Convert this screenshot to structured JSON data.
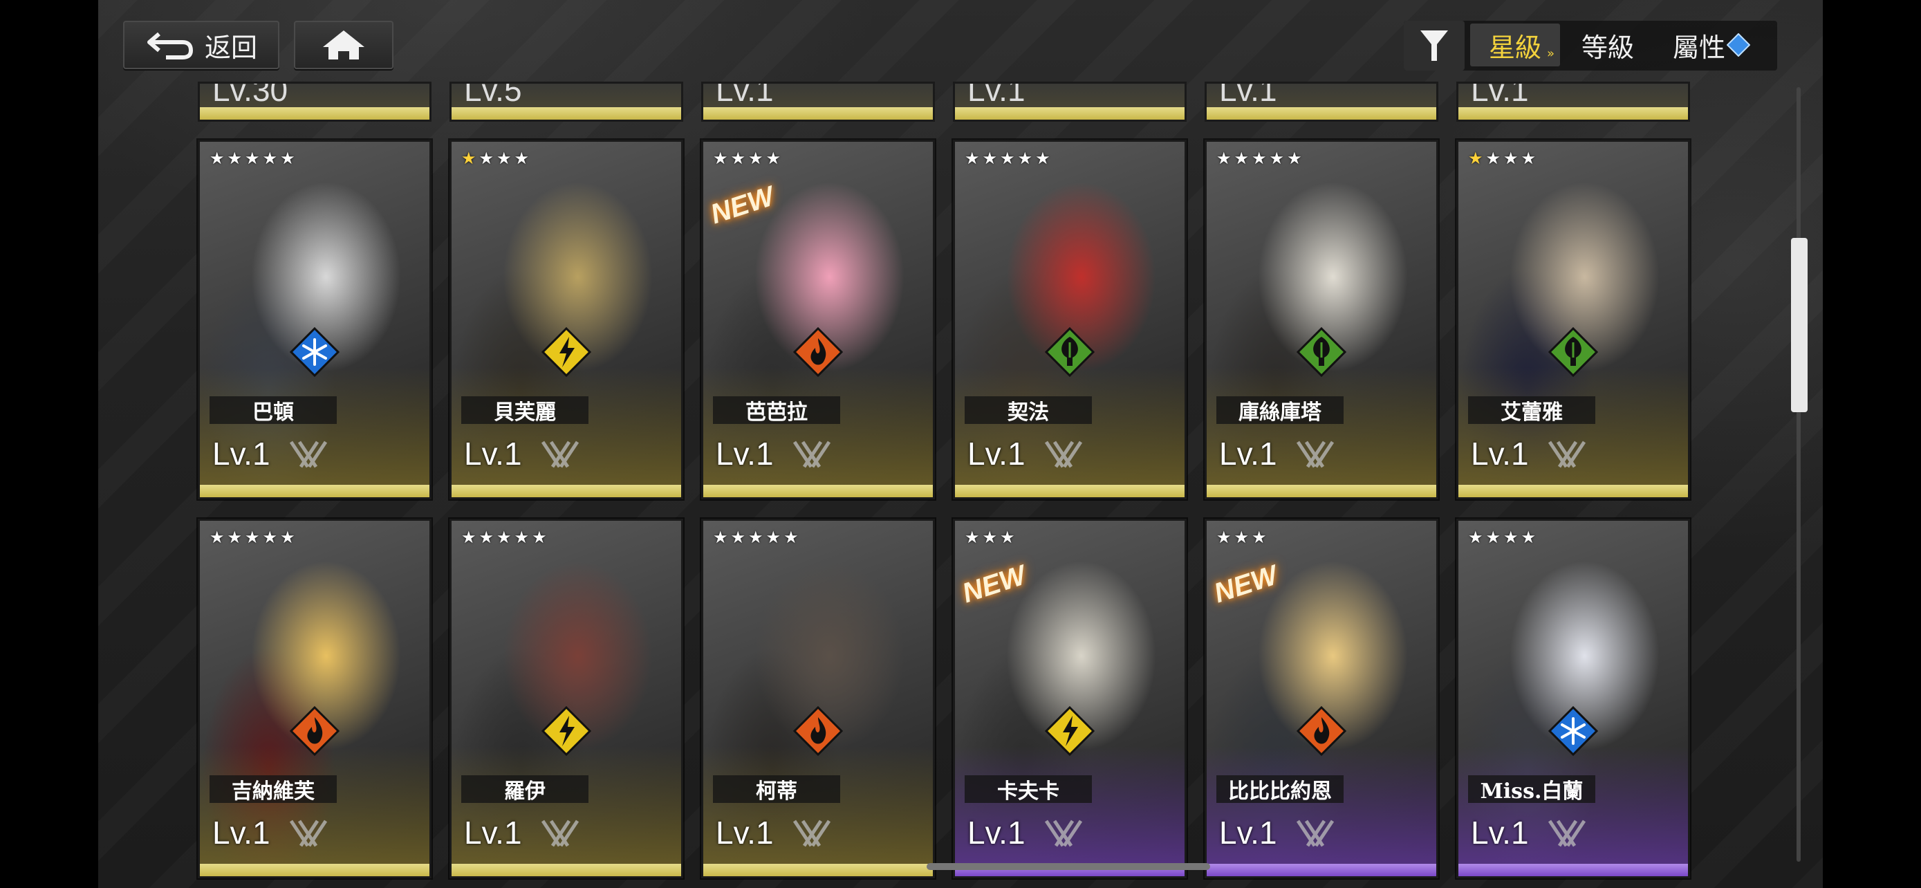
{
  "topbar": {
    "back_label": "返回",
    "sort_star": "星級",
    "sort_level": "等級",
    "sort_attr": "屬性"
  },
  "top_partial_row": [
    "Lv.30",
    "Lv.5",
    "Lv.1",
    "Lv.1",
    "Lv.1",
    "Lv.1"
  ],
  "characters": [
    {
      "name": "巴頓",
      "level": "Lv.1",
      "stars": 5,
      "gold_stars": 0,
      "element": "ice",
      "rarity": "gold",
      "new": false,
      "art": [
        "#d8d8d8",
        "#3a3f48"
      ]
    },
    {
      "name": "貝芙麗",
      "level": "Lv.1",
      "stars": 4,
      "gold_stars": 1,
      "element": "electric",
      "rarity": "gold",
      "new": false,
      "art": [
        "#b8a060",
        "#2f2c26"
      ]
    },
    {
      "name": "芭芭拉",
      "level": "Lv.1",
      "stars": 4,
      "gold_stars": 0,
      "element": "fire",
      "rarity": "gold",
      "new": true,
      "new_label": "NEW",
      "art": [
        "#f0a0b8",
        "#2d2d2d"
      ]
    },
    {
      "name": "契法",
      "level": "Lv.1",
      "stars": 5,
      "gold_stars": 0,
      "element": "nature",
      "rarity": "gold",
      "new": false,
      "art": [
        "#c0302c",
        "#3a3530"
      ]
    },
    {
      "name": "庫絲庫塔",
      "level": "Lv.1",
      "stars": 5,
      "gold_stars": 0,
      "element": "nature",
      "rarity": "gold",
      "new": false,
      "art": [
        "#e0dcd2",
        "#2c2a28"
      ]
    },
    {
      "name": "艾蕾雅",
      "level": "Lv.1",
      "stars": 4,
      "gold_stars": 1,
      "element": "nature",
      "rarity": "gold",
      "new": false,
      "art": [
        "#c8b8a0",
        "#1e2038"
      ]
    },
    {
      "name": "吉納維芙",
      "level": "Lv.1",
      "stars": 5,
      "gold_stars": 0,
      "element": "fire",
      "rarity": "gold",
      "new": false,
      "art": [
        "#e8c060",
        "#5a1a1c"
      ]
    },
    {
      "name": "羅伊",
      "level": "Lv.1",
      "stars": 5,
      "gold_stars": 0,
      "element": "electric",
      "rarity": "gold",
      "new": false,
      "art": [
        "#7a4038",
        "#2a2a2a"
      ]
    },
    {
      "name": "柯蒂",
      "level": "Lv.1",
      "stars": 5,
      "gold_stars": 0,
      "element": "fire",
      "rarity": "gold",
      "new": false,
      "art": [
        "#5a5048",
        "#2a2826"
      ]
    },
    {
      "name": "卡夫卡",
      "level": "Lv.1",
      "stars": 3,
      "gold_stars": 0,
      "element": "electric",
      "rarity": "purple",
      "new": true,
      "new_label": "NEW",
      "art": [
        "#d8d4c8",
        "#2c2c2c"
      ]
    },
    {
      "name": "比比比約恩",
      "level": "Lv.1",
      "stars": 3,
      "gold_stars": 0,
      "element": "fire",
      "rarity": "purple",
      "new": true,
      "new_label": "NEW",
      "art": [
        "#e8c880",
        "#30343a"
      ]
    },
    {
      "name": "Miss.白蘭",
      "level": "Lv.1",
      "stars": 4,
      "gold_stars": 0,
      "element": "ice",
      "rarity": "purple",
      "new": false,
      "art": [
        "#e0e2ea",
        "#3a3c44"
      ]
    }
  ],
  "element_colors": {
    "ice": "#1e6fd6",
    "electric": "#e8c61a",
    "fire": "#e0581a",
    "nature": "#4a9a2a"
  }
}
